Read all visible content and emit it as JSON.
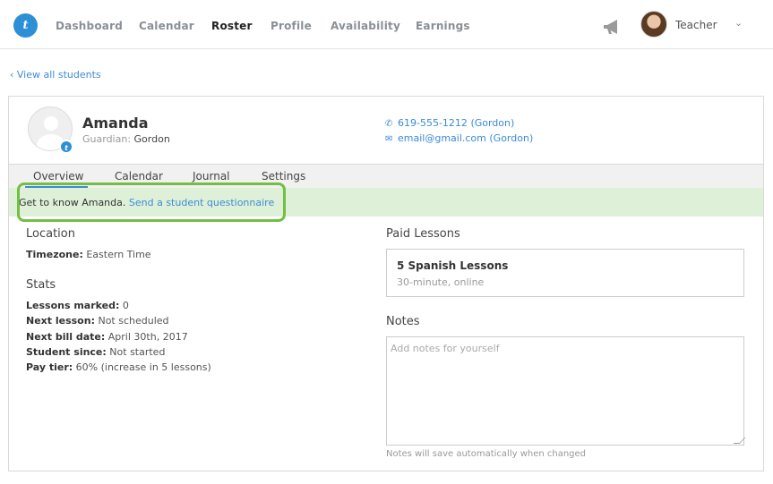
{
  "nav": {
    "logo_text": "t",
    "items": [
      {
        "label": "Dashboard",
        "active": false
      },
      {
        "label": "Calendar",
        "active": false
      },
      {
        "label": "Roster",
        "active": true
      },
      {
        "label": "Profile",
        "active": false
      },
      {
        "label": "Availability",
        "active": false
      },
      {
        "label": "Earnings",
        "active": false
      }
    ],
    "user_label": "Teacher",
    "accent_color": "#2d8fd6"
  },
  "back_link": "‹ View all students",
  "student": {
    "name": "Amanda",
    "guardian_label": "Guardian:",
    "guardian_name": "Gordon",
    "phone": "619-555-1212",
    "phone_suffix": "(Gordon)",
    "email": "email@gmail.com",
    "email_suffix": "(Gordon)"
  },
  "tabs": [
    {
      "label": "Overview",
      "active": true
    },
    {
      "label": "Calendar",
      "active": false
    },
    {
      "label": "Journal",
      "active": false
    },
    {
      "label": "Settings",
      "active": false
    }
  ],
  "banner": {
    "text": "Get to know Amanda.",
    "link": "Send a student questionnaire",
    "highlight_color": "#72bf44"
  },
  "location": {
    "title": "Location",
    "timezone_label": "Timezone:",
    "timezone_value": "Eastern Time"
  },
  "stats": {
    "title": "Stats",
    "rows": [
      {
        "label": "Lessons marked:",
        "value": "0"
      },
      {
        "label": "Next lesson:",
        "value": "Not scheduled"
      },
      {
        "label": "Next bill date:",
        "value": "April 30th, 2017"
      },
      {
        "label": "Student since:",
        "value": "Not started"
      },
      {
        "label": "Pay tier:",
        "value": "60% (increase in 5 lessons)"
      }
    ]
  },
  "paid_lessons": {
    "title": "Paid Lessons",
    "lesson_title": "5 Spanish Lessons",
    "lesson_sub": "30-minute, online"
  },
  "notes": {
    "title": "Notes",
    "placeholder": "Add notes for yourself",
    "hint": "Notes will save automatically when changed"
  }
}
